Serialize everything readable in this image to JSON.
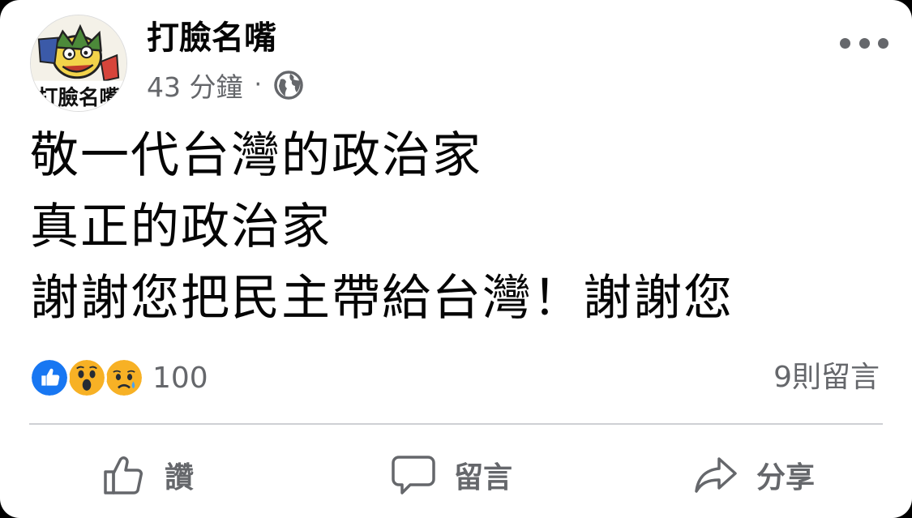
{
  "post": {
    "page_name": "打臉名嘴",
    "timestamp": "43 分鐘",
    "separator": "·",
    "audience_icon": "globe-icon",
    "avatar_text": "打臉名嘴",
    "body_lines": [
      "敬一代台灣的政治家",
      "真正的政治家",
      "謝謝您把民主帶給台灣！謝謝您"
    ]
  },
  "reactions": {
    "icons": [
      "like-reaction-icon",
      "wow-reaction-icon",
      "sad-reaction-icon"
    ],
    "count": "100",
    "comments": "9則留言"
  },
  "actions": {
    "like_label": "讚",
    "comment_label": "留言",
    "share_label": "分享"
  },
  "colors": {
    "like_blue": "#1877f2",
    "emoji_yellow": "#f7b125",
    "secondary_text": "#65676b",
    "divider": "#ced0d4"
  }
}
